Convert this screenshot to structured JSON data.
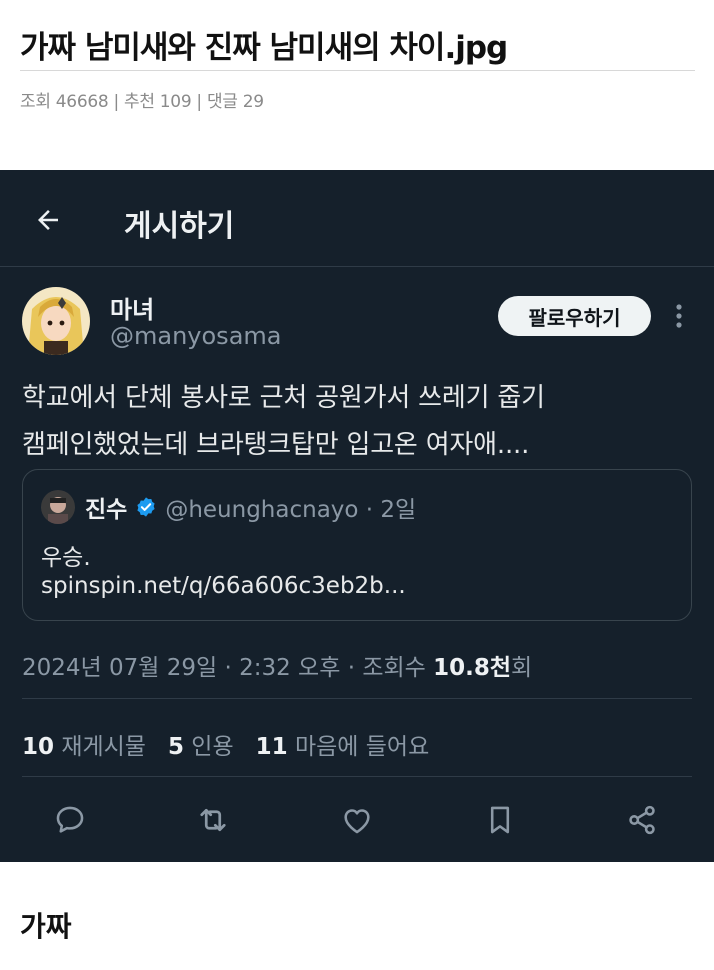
{
  "post": {
    "title": "가짜 남미새와 진짜 남미새의 차이.jpg",
    "meta": "조회 46668 | 추천 109 | 댓글 29",
    "caption": "가짜"
  },
  "screenshot": {
    "header": {
      "title": "게시하기",
      "back_icon": "arrow-left-icon"
    },
    "author": {
      "name": "마녀",
      "handle": "@manyosama",
      "follow_label": "팔로우하기"
    },
    "tweet": {
      "lines": [
        "학교에서 단체 봉사로 근처 공원가서 쓰레기 줍기",
        "캠페인했었는데 브라탱크탑만 입고온 여자애...."
      ]
    },
    "quote": {
      "name": "진수",
      "handle_time": "@heunghacnayo · 2일",
      "text": "우승.",
      "link": "spinspin.net/q/66a606c3eb2b..."
    },
    "timestamp": {
      "prefix": "2024년 07월 29일 · 2:32 오후 · 조회수 ",
      "views": "10.8천",
      "suffix": "회"
    },
    "stats": [
      {
        "count": "10",
        "label": "재게시물"
      },
      {
        "count": "5",
        "label": "인용"
      },
      {
        "count": "11",
        "label": "마음에 들어요"
      }
    ],
    "actions": [
      "reply-icon",
      "repost-icon",
      "like-icon",
      "bookmark-icon",
      "share-icon"
    ],
    "colors": {
      "background": "#15202b",
      "text": "#e7e9ea",
      "muted": "#8b98a5",
      "border": "#38444d",
      "verified": "#1d9bf0",
      "follow_bg": "#eff3f4"
    }
  }
}
